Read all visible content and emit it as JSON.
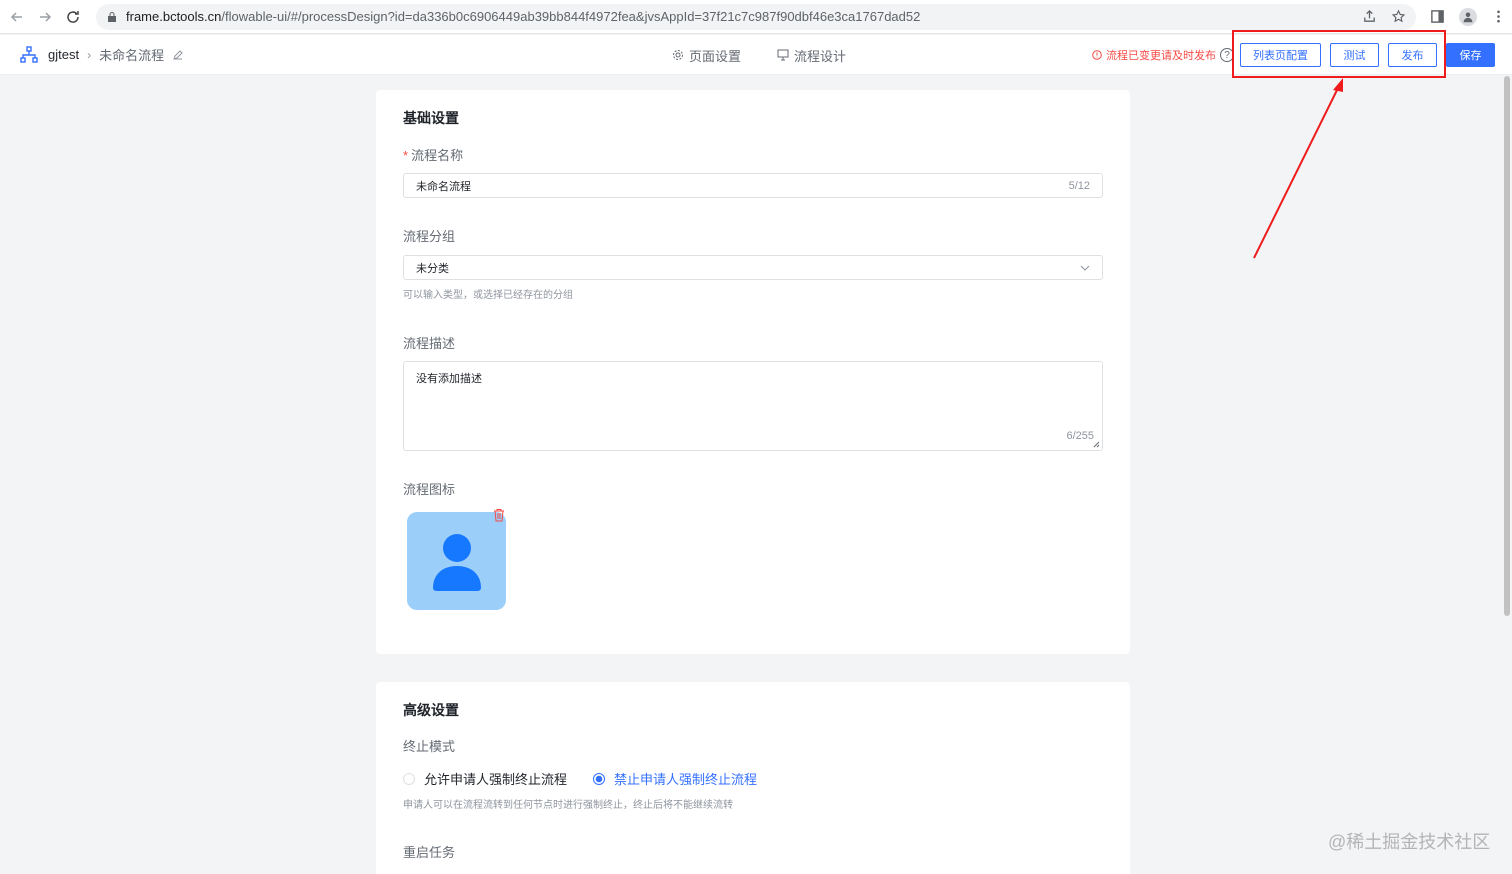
{
  "browser": {
    "url_host": "frame.bctools.cn",
    "url_path": "/flowable-ui/#/processDesign?id=da336b0c6906449ab39bb844f4972fea&jvsAppId=37f21c7c987f90dbf46e3ca1767dad52"
  },
  "header": {
    "app_name": "gjtest",
    "process_name": "未命名流程",
    "tabs": [
      {
        "label": "页面设置",
        "icon": "gear-icon"
      },
      {
        "label": "流程设计",
        "icon": "flow-icon"
      }
    ],
    "warning": "流程已变更请及时发布",
    "help": "?",
    "buttons": {
      "list_config": "列表页配置",
      "test": "测试",
      "publish": "发布",
      "save": "保存"
    },
    "colors": {
      "primary": "#3370ff",
      "warning": "#f54a45",
      "annotation": "#ee1c1c"
    }
  },
  "basic": {
    "title": "基础设置",
    "name_label": "流程名称",
    "name_value": "未命名流程",
    "name_count": "5/12",
    "group_label": "流程分组",
    "group_value": "未分类",
    "group_hint": "可以输入类型，或选择已经存在的分组",
    "desc_label": "流程描述",
    "desc_value": "没有添加描述",
    "desc_count": "6/255",
    "icon_label": "流程图标",
    "icon_name": "user-avatar-icon"
  },
  "advanced": {
    "title": "高级设置",
    "stop_label": "终止模式",
    "options": [
      "允许申请人强制终止流程",
      "禁止申请人强制终止流程"
    ],
    "selected_option": "禁止申请人强制终止流程",
    "stop_hint": "申请人可以在流程流转到任何节点时进行强制终止，终止后将不能继续流转",
    "restart_label": "重启任务"
  },
  "watermark": "@稀土掘金技术社区"
}
